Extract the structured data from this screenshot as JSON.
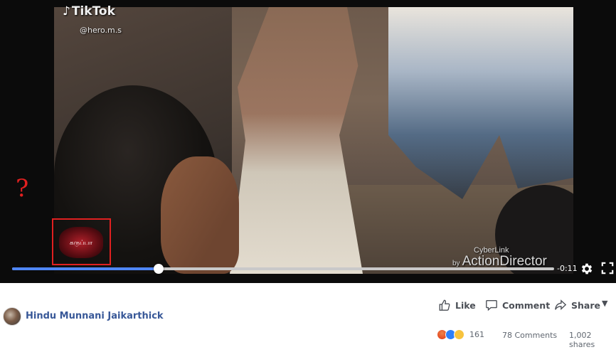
{
  "video": {
    "tiktok_brand": "TikTok",
    "tiktok_handle": "@hero.m.s",
    "annotation_mark": "?",
    "boxed_logo_text": "கருப்பா",
    "watermark_brand": "CyberLink",
    "watermark_by": "by",
    "watermark_product": "ActionDirector",
    "time_remaining": "-0:11",
    "progress": 0.27
  },
  "post": {
    "author_name": "Hindu Munnani Jaikarthick",
    "actions": {
      "like_label": "Like",
      "comment_label": "Comment",
      "share_label": "Share"
    },
    "stats": {
      "reaction_count": "161",
      "comments": "78 Comments",
      "shares": "1,002 shares"
    },
    "reaction_types": [
      "angry",
      "like",
      "sad"
    ]
  },
  "colors": {
    "progress_fill": "#4f86f7",
    "annotation_red": "#e02020",
    "author_link": "#385898"
  }
}
